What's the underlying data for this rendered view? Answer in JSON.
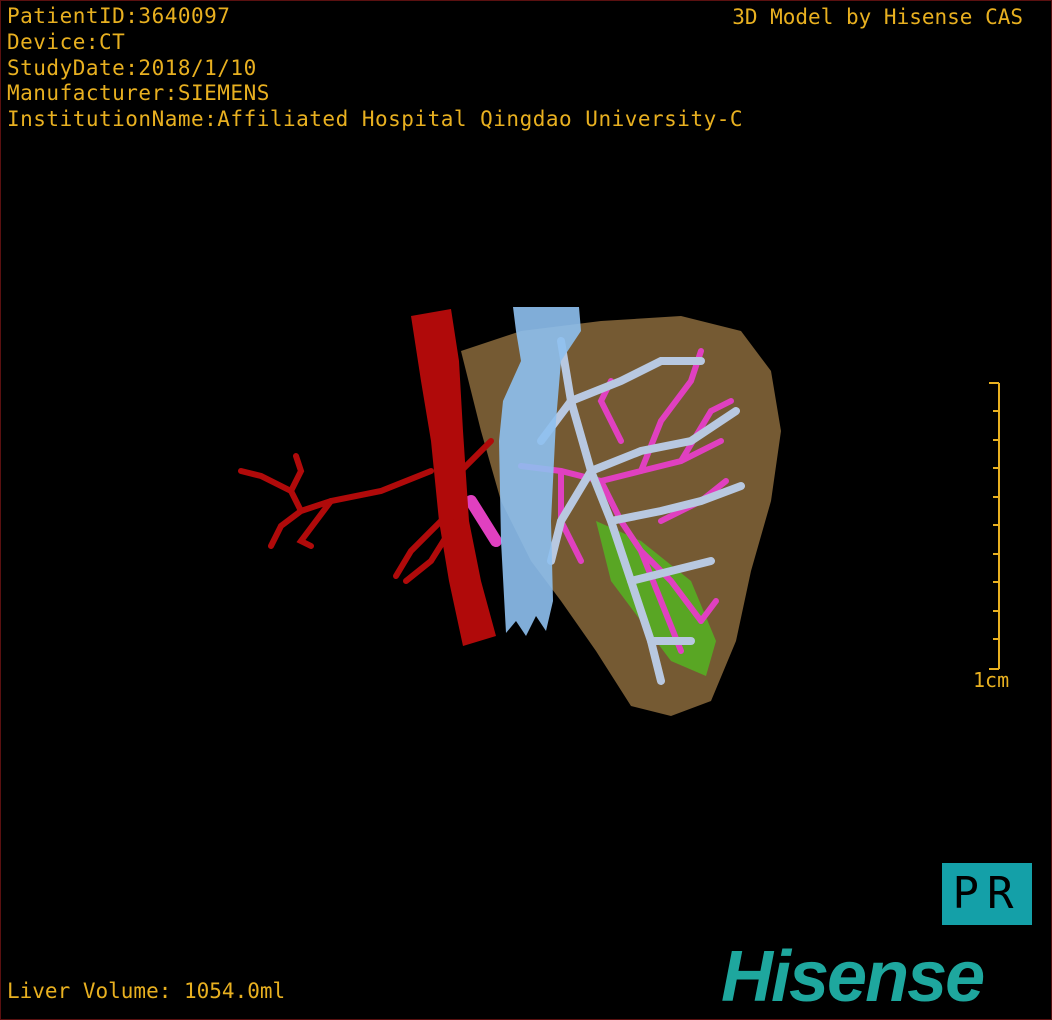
{
  "patient_info": {
    "patient_id": "PatientID:3640097",
    "device": "Device:CT",
    "study_date": "StudyDate:2018/1/10",
    "manufacturer": "Manufacturer:SIEMENS",
    "institution": "InstitutionName:Affiliated Hospital Qingdao University-C"
  },
  "brand_text": "3D Model by Hisense CAS",
  "liver_volume": "Liver Volume: 1054.0ml",
  "scale_bar": {
    "label": "1cm",
    "ticks": 10
  },
  "orientation": "PR",
  "logo": "Hisense",
  "colors": {
    "text": "#e8b020",
    "liver": "#8a6a3c",
    "aorta": "#b00a0a",
    "ivc": "#8ec0f0",
    "portal": "#b8c8e0",
    "hepatic": "#e040c0",
    "gallbladder": "#50c020",
    "brand": "#1ea79e"
  }
}
